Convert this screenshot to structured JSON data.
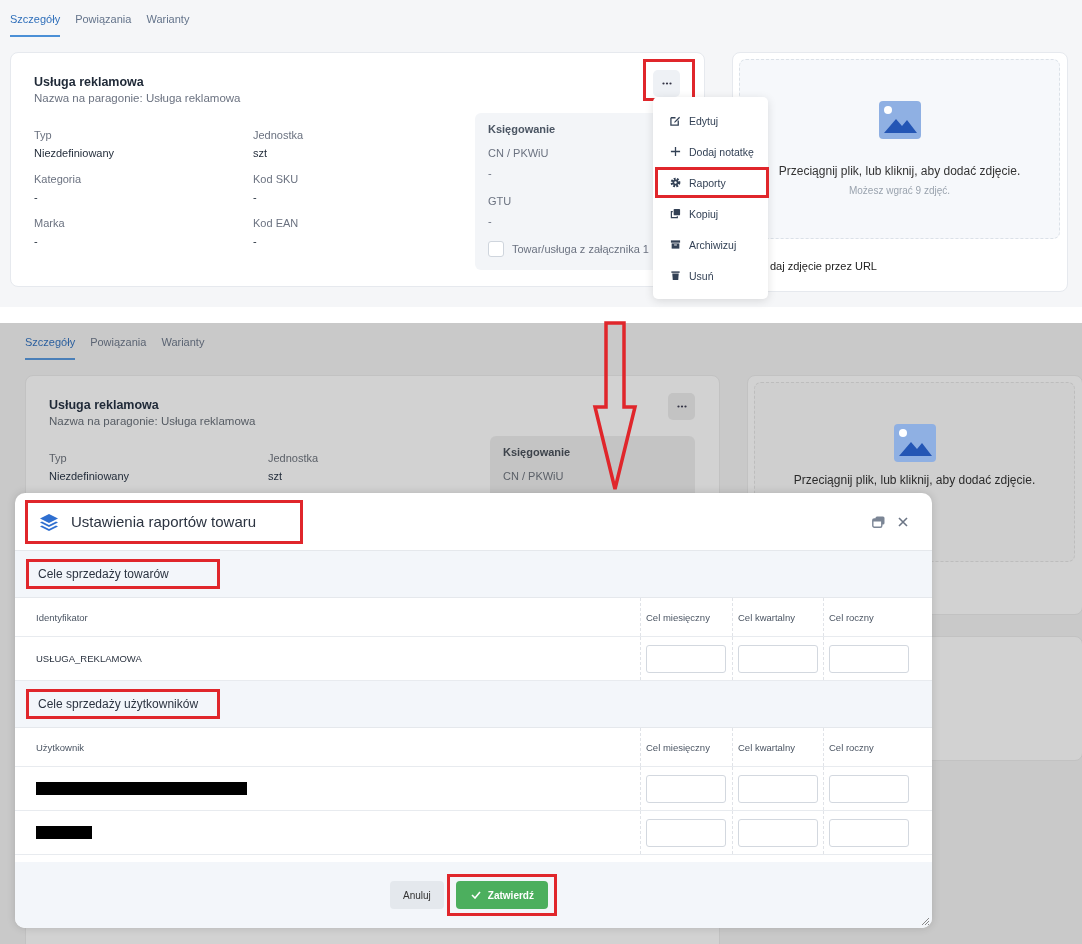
{
  "top_view": {
    "tabs": [
      {
        "label": "Szczegóły",
        "selected": true
      },
      {
        "label": "Powiązania",
        "selected": false
      },
      {
        "label": "Warianty",
        "selected": false
      }
    ],
    "product": {
      "name": "Usługa reklamowa",
      "receipt_name": "Nazwa na paragonie: Usługa reklamowa",
      "more_highlighted": true,
      "fields": [
        {
          "label": "Typ",
          "value": "Niezdefiniowany"
        },
        {
          "label": "Jednostka",
          "value": "szt"
        },
        {
          "label": "Kategoria",
          "value": "-"
        },
        {
          "label": "Kod SKU",
          "value": "-"
        },
        {
          "label": "Marka",
          "value": "-"
        },
        {
          "label": "Kod EAN",
          "value": "-"
        }
      ],
      "accounting": {
        "title": "Księgowanie",
        "fields": [
          {
            "label": "CN / PKWiU",
            "value": "-"
          },
          {
            "label": "GTU",
            "value": "-"
          }
        ],
        "checkbox": {
          "label": "Towar/usługa z załącznika 1",
          "checked": false
        }
      }
    },
    "menu": [
      {
        "label": "Edytuj",
        "kind": "edit",
        "highlighted": false
      },
      {
        "label": "Dodaj notatkę",
        "kind": "add",
        "highlighted": false
      },
      {
        "label": "Raporty",
        "kind": "settings",
        "highlighted": true
      },
      {
        "label": "Kopiuj",
        "kind": "copy",
        "highlighted": false
      },
      {
        "label": "Archiwizuj",
        "kind": "archive",
        "highlighted": false
      },
      {
        "label": "Usuń",
        "kind": "delete",
        "highlighted": false
      }
    ],
    "upload": {
      "text": "Przeciągnij plik, lub kliknij, aby dodać zdjęcie.",
      "hint": "Możesz wgrać 9 zdjęć.",
      "url_link": "daj zdjęcie przez URL"
    }
  },
  "step_arrow": true,
  "bottom_view": {
    "tabs": [
      {
        "label": "Szczegóły",
        "selected": true
      },
      {
        "label": "Powiązania",
        "selected": false
      },
      {
        "label": "Warianty",
        "selected": false
      }
    ],
    "product": {
      "name": "Usługa reklamowa",
      "receipt_name": "Nazwa na paragonie: Usługa reklamowa",
      "more_highlighted": false,
      "fields": [
        {
          "label": "Typ",
          "value": "Niezdefiniowany"
        },
        {
          "label": "Jednostka",
          "value": "szt"
        }
      ],
      "accounting": {
        "title": "Księgowanie",
        "fields": [
          {
            "label": "CN / PKWiU"
          }
        ]
      }
    },
    "upload": {
      "text": "Przeciągnij plik, lub kliknij, aby dodać zdjęcie."
    },
    "dialog": {
      "title": "Ustawienia raportów towaru",
      "title_highlighted": true,
      "sections": [
        {
          "title": "Cele sprzedaży towarów",
          "highlighted": true,
          "columns": [
            "Identyfikator",
            "Cel miesięczny",
            "Cel kwartalny",
            "Cel roczny"
          ],
          "rows": [
            {
              "kind": "text",
              "name": "USŁUGA_REKLAMOWA"
            }
          ]
        },
        {
          "title": "Cele sprzedaży użytkowników",
          "highlighted": true,
          "columns": [
            "Użytkownik",
            "Cel miesięczny",
            "Cel kwartalny",
            "Cel roczny"
          ],
          "rows": [
            {
              "kind": "redacted"
            },
            {
              "kind": "redacted"
            }
          ]
        }
      ],
      "buttons": [
        {
          "label": "Anuluj",
          "kind": "secondary",
          "highlighted": false
        },
        {
          "label": "Zatwierdź",
          "kind": "primary",
          "highlighted": true
        }
      ]
    }
  }
}
